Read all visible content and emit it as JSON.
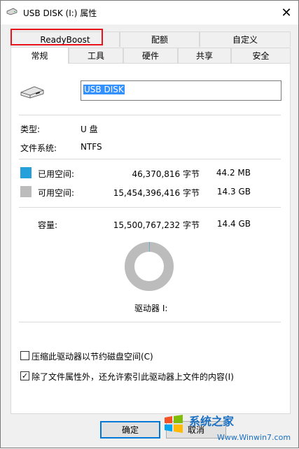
{
  "window": {
    "title": "USB DISK (I:) 属性",
    "close_glyph": "✕"
  },
  "tabs_back": [
    {
      "label": "ReadyBoost",
      "name": "tab-readyboost"
    },
    {
      "label": "配额",
      "name": "tab-quota"
    },
    {
      "label": "自定义",
      "name": "tab-customize"
    }
  ],
  "tabs_front": [
    {
      "label": "常规",
      "name": "tab-general",
      "active": true
    },
    {
      "label": "工具",
      "name": "tab-tools"
    },
    {
      "label": "硬件",
      "name": "tab-hardware"
    },
    {
      "label": "共享",
      "name": "tab-sharing"
    },
    {
      "label": "安全",
      "name": "tab-security"
    }
  ],
  "general": {
    "drive_name": "USB DISK",
    "type_label": "类型:",
    "type_value": "U 盘",
    "fs_label": "文件系统:",
    "fs_value": "NTFS",
    "used_label": "已用空间:",
    "used_bytes": "46,370,816 字节",
    "used_size": "44.2 MB",
    "free_label": "可用空间:",
    "free_bytes": "15,454,396,416 字节",
    "free_size": "14.3 GB",
    "capacity_label": "容量:",
    "capacity_bytes": "15,500,767,232 字节",
    "capacity_size": "14.4 GB",
    "drive_label": "驱动器 I:",
    "used_fraction": 0.003,
    "compress_label": "压缩此驱动器以节约磁盘空间(C)",
    "compress_checked": false,
    "index_label": "除了文件属性外，还允许索引此驱动器上文件的内容(I)",
    "index_checked": true,
    "check_glyph": "✓"
  },
  "buttons": {
    "ok": "确定",
    "cancel": "取消"
  },
  "watermark": {
    "brand": "系统之家",
    "url": "Www.Winwin7.com"
  },
  "colors": {
    "used": "#26a0da",
    "free": "#bcbcbc",
    "highlight": "#e8131b",
    "accent": "#0078d7"
  }
}
